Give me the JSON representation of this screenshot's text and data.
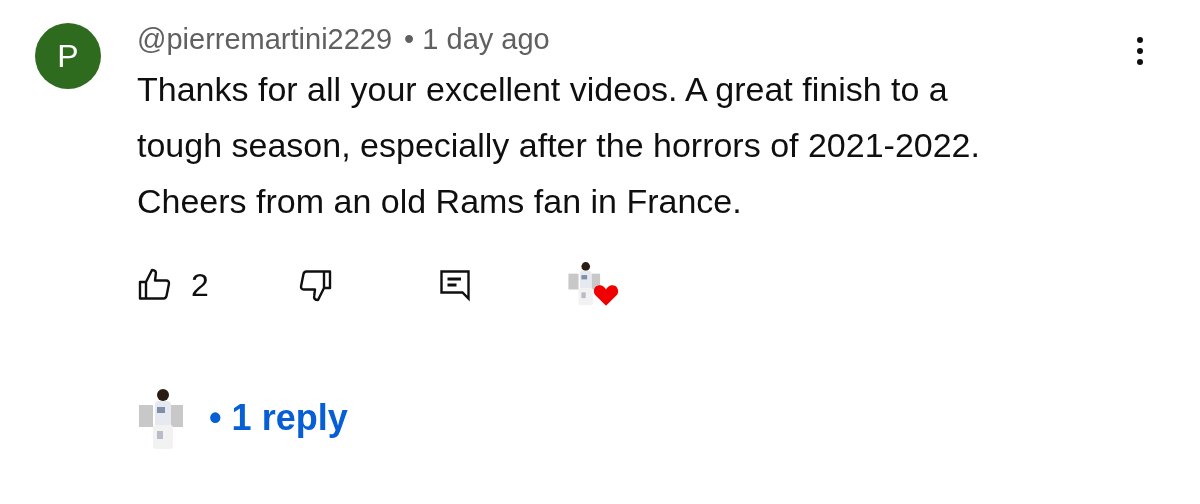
{
  "comment": {
    "avatar_letter": "P",
    "author": "@pierremartini2229",
    "time": "• 1 day ago",
    "text": "Thanks for all your excellent videos. A great finish to a tough season, especially after the horrors of 2021-2022. Cheers from an old Rams fan in France.",
    "likes": "2",
    "creator_hearted": true
  },
  "replies": {
    "label": "• 1 reply"
  }
}
